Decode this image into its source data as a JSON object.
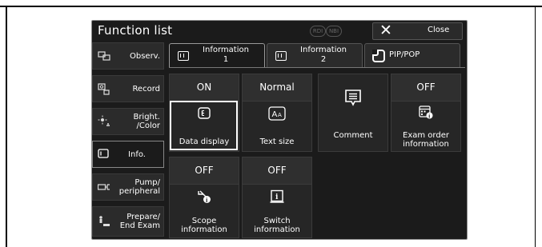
{
  "window": {
    "title": "Function list",
    "indicator_rdi": "RDI",
    "indicator_nbi": "NBI",
    "close_label": "Close"
  },
  "sidebar": {
    "items": [
      {
        "label": "Observ.",
        "icon": "observ-icon"
      },
      {
        "label": "Record",
        "icon": "record-icon"
      },
      {
        "label": "Bright.\n/Color",
        "icon": "brightness-icon"
      },
      {
        "label": "Info.",
        "icon": "info-icon"
      },
      {
        "label": "Pump/\nperipheral",
        "icon": "pump-icon"
      },
      {
        "label": "Prepare/\nEnd Exam",
        "icon": "prepare-icon"
      }
    ],
    "active_index": 3
  },
  "tabs": [
    {
      "line1": "Information",
      "line2": "1"
    },
    {
      "line1": "Information",
      "line2": "2"
    },
    {
      "line1": "PIP/POP",
      "line2": ""
    }
  ],
  "active_tab": 0,
  "tiles": [
    {
      "status": "ON",
      "label": "Data display",
      "icon": "data-display-icon"
    },
    {
      "status": "Normal",
      "label": "Text size",
      "icon": "text-size-icon"
    },
    {
      "status": "",
      "label": "Comment",
      "icon": "comment-icon"
    },
    {
      "status": "OFF",
      "label": "Exam order\ninformation",
      "icon": "exam-order-icon"
    },
    {
      "status": "OFF",
      "label": "Scope\ninformation",
      "icon": "scope-info-icon"
    },
    {
      "status": "OFF",
      "label": "Switch\ninformation",
      "icon": "switch-info-icon"
    }
  ]
}
